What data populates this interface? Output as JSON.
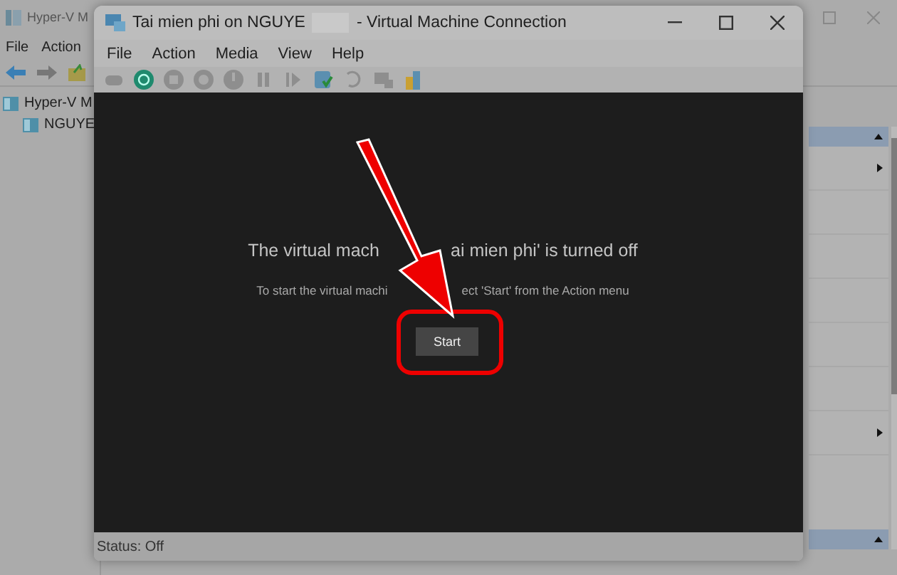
{
  "host_window": {
    "title": "Hyper-V M",
    "menu": [
      "File",
      "Action"
    ],
    "tree": [
      {
        "label": "Hyper-V M",
        "children": [
          {
            "label": "NGUYE"
          }
        ]
      }
    ]
  },
  "vm_window": {
    "title_parts": [
      "Tai mien phi on NGUYE",
      "- Virtual Machine Connection"
    ],
    "menu": [
      "File",
      "Action",
      "Media",
      "View",
      "Help"
    ],
    "toolbar": [
      {
        "kind": "ctrl-alt-del",
        "disabled": true
      },
      {
        "kind": "start",
        "disabled": false
      },
      {
        "kind": "stop",
        "disabled": true
      },
      {
        "kind": "shutdown",
        "disabled": true
      },
      {
        "kind": "power",
        "disabled": true
      },
      {
        "kind": "pause",
        "disabled": true
      },
      {
        "kind": "resume",
        "disabled": true
      },
      {
        "kind": "checkpoint",
        "disabled": false
      },
      {
        "kind": "revert",
        "disabled": true
      },
      {
        "kind": "session",
        "disabled": true
      },
      {
        "kind": "share",
        "disabled": false
      }
    ],
    "headline_parts": [
      "The virtual mach",
      "ai mien phi' is turned off"
    ],
    "hint_parts": [
      "To start the virtual machi",
      "ect 'Start' from the Action menu"
    ],
    "start_button": "Start",
    "status": "Status: Off"
  }
}
